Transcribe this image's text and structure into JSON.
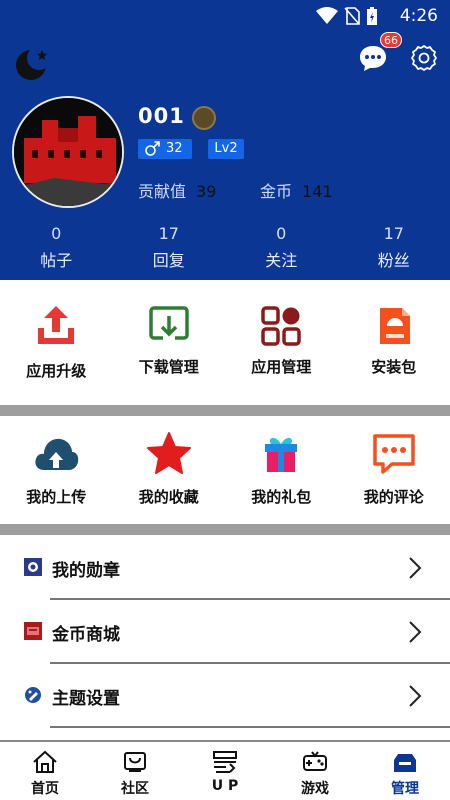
{
  "status": {
    "time": "4:26",
    "icons": [
      "wifi-icon",
      "no-sim-icon",
      "battery-charging-icon"
    ]
  },
  "header": {
    "message_badge": "66",
    "username": "001",
    "gender_count": "32",
    "level": "Lv2",
    "contribution_label": "贡献值",
    "contribution_value": "39",
    "coins_label": "金币",
    "coins_value": "141"
  },
  "counts": [
    {
      "num": "0",
      "label": "帖子"
    },
    {
      "num": "17",
      "label": "回复"
    },
    {
      "num": "0",
      "label": "关注"
    },
    {
      "num": "17",
      "label": "粉丝"
    }
  ],
  "grid1": [
    {
      "label": "应用升级",
      "icon": "upload-icon"
    },
    {
      "label": "下载管理",
      "icon": "download-icon"
    },
    {
      "label": "应用管理",
      "icon": "apps-icon"
    },
    {
      "label": "安装包",
      "icon": "apk-icon"
    }
  ],
  "grid2": [
    {
      "label": "我的上传",
      "icon": "cloud-upload-icon"
    },
    {
      "label": "我的收藏",
      "icon": "star-icon"
    },
    {
      "label": "我的礼包",
      "icon": "gift-icon"
    },
    {
      "label": "我的评论",
      "icon": "comment-icon"
    }
  ],
  "list": [
    {
      "label": "我的勋章",
      "icon": "medal-icon"
    },
    {
      "label": "金币商城",
      "icon": "coin-shop-icon"
    },
    {
      "label": "主题设置",
      "icon": "theme-icon"
    }
  ],
  "nav": [
    {
      "label": "首页",
      "icon": "home-icon"
    },
    {
      "label": "社区",
      "icon": "community-icon"
    },
    {
      "label": "U P",
      "icon": "up-icon"
    },
    {
      "label": "游戏",
      "icon": "gamepad-icon"
    },
    {
      "label": "管理",
      "icon": "manage-icon"
    }
  ],
  "colors": {
    "primary": "#0b3694",
    "accent": "#1466e8",
    "red": "#e53935"
  }
}
